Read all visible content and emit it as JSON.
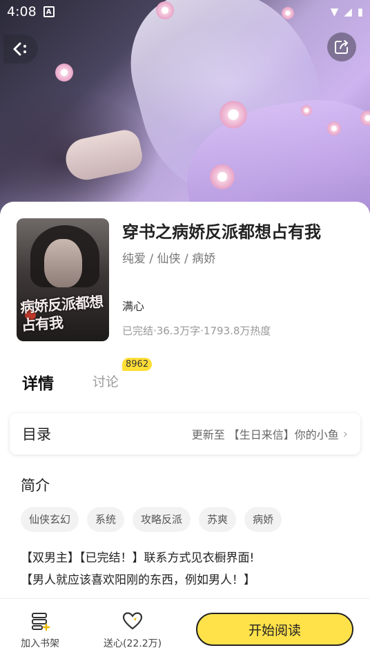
{
  "status_bar": {
    "time": "4:08",
    "notification_icon": "A"
  },
  "header": {
    "back_icon": "back-arrow-icon",
    "share_icon": "share-icon"
  },
  "book": {
    "title": "穿书之病娇反派都想占有我",
    "tags": "纯爱 / 仙侠 / 病娇",
    "author": "满心",
    "stats": "已完结·36.3万字·1793.8万热度",
    "cover_title": "病娇反派都想占有我"
  },
  "tabs": {
    "detail": "详情",
    "discuss": "讨论",
    "discuss_count": "8962"
  },
  "toc": {
    "label": "目录",
    "latest": "更新至 【生日来信】你的小鱼"
  },
  "intro": {
    "title": "简介",
    "chips": [
      "仙侠玄幻",
      "系统",
      "攻略反派",
      "苏爽",
      "病娇"
    ],
    "lines": [
      "【双男主】【已完结！】联系方式见衣橱界面!",
      "【男人就应该喜欢阳刚的东西，例如男人！】"
    ]
  },
  "bottom_bar": {
    "shelf_label": "加入书架",
    "heart_label": "送心(22.2万)",
    "read_label": "开始阅读"
  },
  "colors": {
    "accent": "#ffe24a",
    "badge": "#ffde36"
  }
}
